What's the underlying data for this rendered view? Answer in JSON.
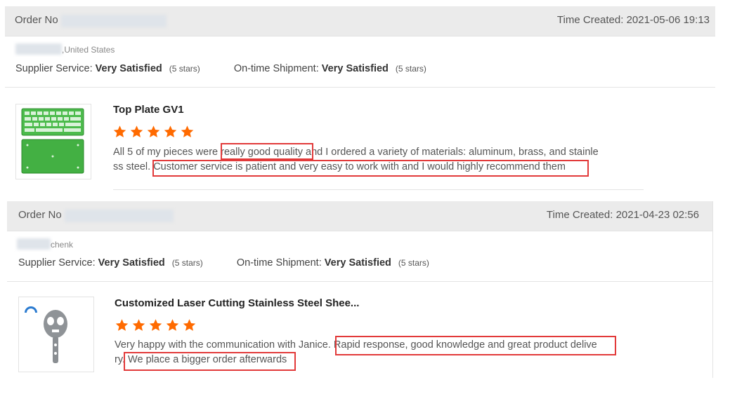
{
  "orders": [
    {
      "order_label": "Order No",
      "time_created": "Time Created: 2021-05-06 19:13",
      "buyer": ",United States",
      "supplier_service_label": "Supplier Service:",
      "supplier_service_value": "Very Satisfied",
      "supplier_service_stars": "(5 stars)",
      "shipment_label": "On-time Shipment:",
      "shipment_value": "Very Satisfied",
      "shipment_stars": "(5 stars)",
      "product_title": "Top Plate GV1",
      "rating": 5,
      "review_line1": "All 5 of my pieces were really good quality and I ordered a variety of materials: aluminum, brass, and stainle",
      "review_line2": "ss steel. Customer service is patient and very easy to work with and I would highly recommend them",
      "product_image": "green-keyboard-plate-image"
    },
    {
      "order_label": "Order No",
      "time_created": "Time Created: 2021-04-23 02:56",
      "buyer": "chenk",
      "supplier_service_label": "Supplier Service:",
      "supplier_service_value": "Very Satisfied",
      "supplier_service_stars": "(5 stars)",
      "shipment_label": "On-time Shipment:",
      "shipment_value": "Very Satisfied",
      "shipment_stars": "(5 stars)",
      "product_title": "Customized Laser Cutting Stainless Steel Shee...",
      "rating": 5,
      "review_line1": "Very happy with the communication with Janice. Rapid response, good knowledge and great product delive",
      "review_line2": "ry. We place a bigger order afterwards",
      "product_image": "steel-bottle-opener-image"
    }
  ],
  "colors": {
    "star": "#ff6a00",
    "highlight_box": "#e23a3a",
    "header_bg": "#ebebeb"
  }
}
